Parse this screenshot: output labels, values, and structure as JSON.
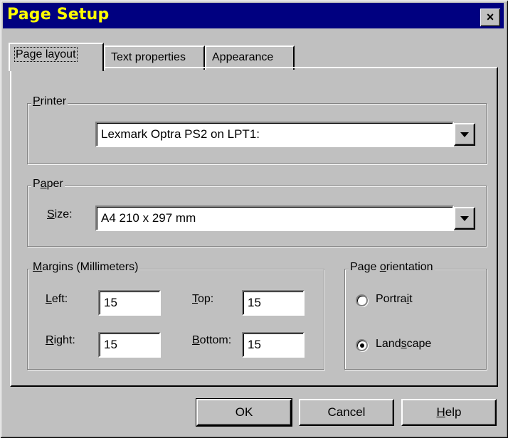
{
  "window": {
    "title": "Page Setup",
    "close_glyph": "×"
  },
  "tabs": [
    {
      "label": "Page layout",
      "active": true
    },
    {
      "label": "Text properties",
      "active": false
    },
    {
      "label": "Appearance",
      "active": false
    }
  ],
  "printer": {
    "group_label_pre": "",
    "group_label_u": "P",
    "group_label_post": "rinter",
    "selected": "Lexmark Optra PS2 on LPT1:"
  },
  "paper": {
    "group_label_pre": "P",
    "group_label_u": "a",
    "group_label_post": "per",
    "size_label_u": "S",
    "size_label_post": "ize:",
    "selected": "A4 210 x 297 mm"
  },
  "margins": {
    "group_label_pre": "",
    "group_label_u": "M",
    "group_label_post": "argins (Millimeters)",
    "left": {
      "label_u": "L",
      "label_post": "eft:",
      "value": "15"
    },
    "top": {
      "label_u": "T",
      "label_post": "op:",
      "value": "15"
    },
    "right": {
      "label_u": "R",
      "label_post": "ight:",
      "value": "15"
    },
    "bottom": {
      "label_u": "B",
      "label_post": "ottom:",
      "value": "15"
    }
  },
  "orientation": {
    "group_label_pre": "Page ",
    "group_label_u": "o",
    "group_label_post": "rientation",
    "portrait": {
      "label_pre": "Portra",
      "label_u": "i",
      "label_post": "t",
      "selected": false
    },
    "landscape": {
      "label_pre": "Land",
      "label_u": "s",
      "label_post": "cape",
      "selected": true
    }
  },
  "buttons": {
    "ok": "OK",
    "cancel": "Cancel",
    "help_u": "H",
    "help_post": "elp"
  }
}
